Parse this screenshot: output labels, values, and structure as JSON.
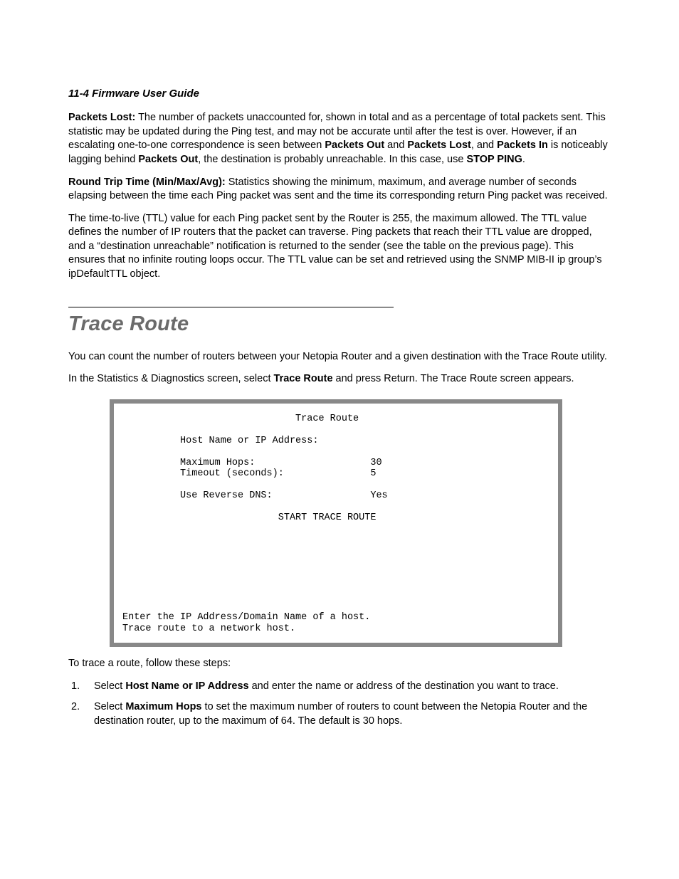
{
  "header": {
    "section_num": "11-4",
    "doc_title": "Firmware User Guide"
  },
  "p_packets_lost": {
    "label": "Packets Lost:",
    "t1": "  The number of packets unaccounted for, shown in total and as a percentage of total packets sent. This statistic may be updated during the Ping test, and may not be accurate until after the test is over. However, if an escalating one-to-one correspondence is seen between ",
    "b1": "Packets Out",
    "t2": " and ",
    "b2": "Packets Lost",
    "t3": ", and ",
    "b3": "Packets In",
    "t4": " is noticeably lagging behind ",
    "b4": "Packets Out",
    "t5": ", the destination is probably unreachable. In this case, use ",
    "b5": "STOP PING",
    "t6": "."
  },
  "p_rtt": {
    "label": "Round Trip Time (Min/Max/Avg):",
    "text": "  Statistics showing the minimum, maximum, and average number of seconds elapsing between the time each Ping packet was sent and the time its corresponding return Ping packet was received."
  },
  "p_ttl": "The time-to-live (TTL) value for each Ping packet sent by the Router is 255, the maximum allowed. The TTL value defines the number of IP routers that the packet can traverse. Ping packets that reach their TTL value are dropped, and a “destination unreachable” notification is returned to the sender (see the table on the previous page). This ensures that no infinite routing loops occur. The TTL value can be set and retrieved using the SNMP MIB-II ip group’s ipDefaultTTL object.",
  "section_title": "Trace Route",
  "p_trace1": "You can count the number of routers between your Netopia Router and a given destination with the Trace Route utility.",
  "p_trace2": {
    "t1": "In the Statistics & Diagnostics screen, select ",
    "b1": "Trace Route",
    "t2": " and press Return. The Trace Route screen appears."
  },
  "terminal": "                              Trace Route\n\n          Host Name or IP Address:\n\n          Maximum Hops:                    30\n          Timeout (seconds):               5\n\n          Use Reverse DNS:                 Yes\n\n                           START TRACE ROUTE\n\n\n\n\n\n\n\n\nEnter the IP Address/Domain Name of a host.\nTrace route to a network host.",
  "p_steps_intro": "To trace a route, follow these steps:",
  "steps": {
    "s1": {
      "t1": "Select ",
      "b1": "Host Name or IP Address",
      "t2": " and enter the name or address of the destination you want to trace."
    },
    "s2": {
      "t1": "Select ",
      "b1": "Maximum Hops",
      "t2": " to set the maximum number of routers to count between the Netopia Router and the destination router, up to the maximum of 64. The default is 30 hops."
    }
  }
}
